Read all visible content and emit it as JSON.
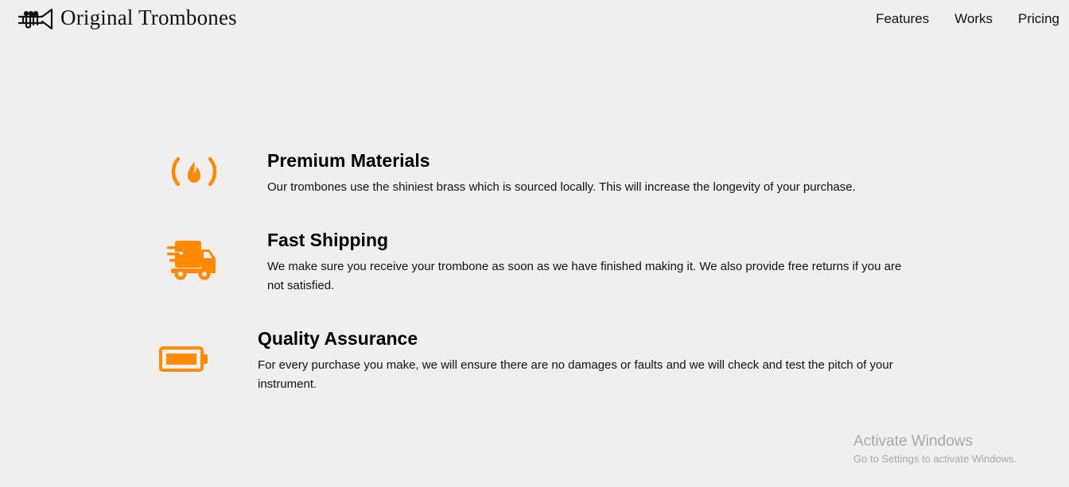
{
  "brand": {
    "name": "Original Trombones",
    "logo_icon": "trombone-icon"
  },
  "nav": {
    "items": [
      {
        "label": "Features"
      },
      {
        "label": "Works"
      },
      {
        "label": "Pricing"
      }
    ]
  },
  "features": [
    {
      "icon": "fire-icon",
      "title": "Premium Materials",
      "description": "Our trombones use the shiniest brass which is sourced locally. This will increase the longevity of your purchase."
    },
    {
      "icon": "shipping-truck-icon",
      "title": "Fast Shipping",
      "description": "We make sure you receive your trombone as soon as we have finished making it. We also provide free returns if you are not satisfied."
    },
    {
      "icon": "battery-full-icon",
      "title": "Quality Assurance",
      "description": "For every purchase you make, we will ensure there are no damages or faults and we will check and test the pitch of your instrument."
    }
  ],
  "colors": {
    "accent": "#ff8a00",
    "background": "#efefef",
    "text": "#111111"
  },
  "os_watermark": {
    "title": "Activate Windows",
    "subtitle": "Go to Settings to activate Windows."
  }
}
